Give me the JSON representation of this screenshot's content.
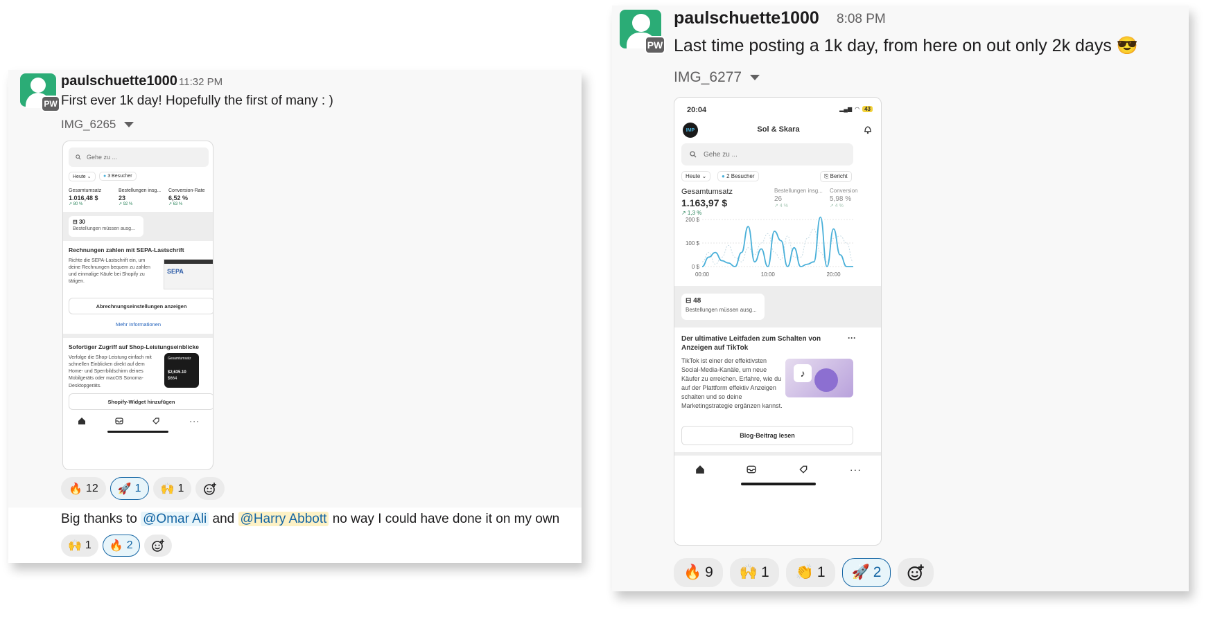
{
  "left": {
    "username": "paulschuette1000",
    "time": "11:32 PM",
    "avatar_initials": "PW",
    "message": "First ever 1k day! Hopefully the first of many : )",
    "file_name": "IMG_6265",
    "phone": {
      "search_placeholder": "Gehe zu ...",
      "filter_today": "Heute",
      "visitors": "3 Besucher",
      "metrics": [
        {
          "label": "Gesamtumsatz",
          "value": "1.016,48 $",
          "change": "↗ 80 %"
        },
        {
          "label": "Bestellungen insg...",
          "value": "23",
          "change": "↗ 92 %"
        },
        {
          "label": "Conversion-Rate",
          "value": "6,52 %",
          "change": "↗ 63 %"
        }
      ],
      "orders_count": "30",
      "orders_text": "Bestellungen müssen ausg...",
      "sepa_title": "Rechnungen zahlen mit SEPA-Lastschrift",
      "sepa_text": "Richte die SEPA-Lastschrift ein, um deine Rechnungen bequem zu zahlen und einmalige Käufe bei Shopify zu tätigen.",
      "sepa_logo": "SEPA",
      "sepa_button": "Abrechnungseinstellungen anzeigen",
      "more_info": "Mehr Informationen",
      "insights_title": "Sofortiger Zugriff auf Shop-Leistungseinblicke",
      "insights_text": "Verfolge die Shop-Leistung einfach mit schnellen Einblicken direkt auf dem Home- und Sperrbildschirm deines Mobilgeräts oder macOS Sonoma-Desktopgeräts.",
      "widget_button": "Shopify-Widget hinzufügen",
      "widget_label": "Gesamtumsatz",
      "widget_value": "$2,635.10",
      "widget_value2": "$664"
    },
    "reactions": [
      {
        "emoji": "🔥",
        "count": "12",
        "active": false
      },
      {
        "emoji": "🚀",
        "count": "1",
        "active": true
      },
      {
        "emoji": "🙌",
        "count": "1",
        "active": false
      }
    ],
    "followup": {
      "prefix": "Big thanks to",
      "mention1": "@Omar Ali",
      "middle": "and",
      "mention2": "@Harry Abbott",
      "suffix": "no way I could have done it on my own"
    },
    "followup_reactions": [
      {
        "emoji": "🙌",
        "count": "1",
        "active": false
      },
      {
        "emoji": "🔥",
        "count": "2",
        "active": true
      }
    ]
  },
  "right": {
    "username": "paulschuette1000",
    "time": "8:08 PM",
    "avatar_initials": "PW",
    "message": "Last time posting a 1k day, from here on out only 2k days",
    "message_emoji": "😎",
    "file_name": "IMG_6277",
    "phone": {
      "status_time": "20:04",
      "battery": "43",
      "store_logo": "IMP",
      "store_name": "Sol & Skara",
      "search_placeholder": "Gehe zu ...",
      "filter_today": "Heute",
      "visitors": "2 Besucher",
      "report": "Bericht",
      "metrics": [
        {
          "label": "Gesamtumsatz",
          "value": "1.163,97 $",
          "change": "↗ 1,3 %"
        },
        {
          "label": "Bestellungen insg...",
          "value": "26",
          "change": "↗ 4 %"
        },
        {
          "label": "Conversion",
          "value": "5,98 %",
          "change": "↗ 4 %"
        }
      ],
      "orders_count": "48",
      "orders_text": "Bestellungen müssen ausg...",
      "blog_title": "Der ultimative Leitfaden zum Schalten von Anzeigen auf TikTok",
      "blog_more": "···",
      "blog_text": "TikTok ist einer der effektivsten Social-Media-Kanäle, um neue Käufer zu erreichen. Erfahre, wie du auf der Plattform effektiv Anzeigen schalten und so deine Marketingstrategie ergänzen kannst.",
      "blog_button": "Blog-Beitrag lesen"
    },
    "reactions": [
      {
        "emoji": "🔥",
        "count": "9",
        "active": false
      },
      {
        "emoji": "🙌",
        "count": "1",
        "active": false
      },
      {
        "emoji": "👏",
        "count": "1",
        "active": false
      },
      {
        "emoji": "🚀",
        "count": "2",
        "active": true
      }
    ]
  },
  "chart_data": {
    "type": "line",
    "title": "",
    "xlabel": "",
    "ylabel": "",
    "x_ticks": [
      "00:00",
      "10:00",
      "20:00"
    ],
    "y_ticks": [
      "0 $",
      "100 $",
      "200 $"
    ],
    "ylim": [
      0,
      200
    ],
    "x": [
      0,
      1,
      2,
      3,
      4,
      5,
      6,
      7,
      8,
      9,
      10,
      11,
      12,
      13,
      14,
      15,
      16,
      17,
      18,
      19,
      20,
      21,
      22,
      23
    ],
    "series": [
      {
        "values": [
          0,
          40,
          60,
          25,
          15,
          0,
          60,
          170,
          20,
          75,
          0,
          150,
          110,
          0,
          80,
          0,
          10,
          20,
          210,
          0,
          160,
          50,
          0,
          0
        ],
        "color": "#4ab0d9"
      },
      {
        "values": [
          20,
          60,
          10,
          40,
          90,
          40,
          20,
          80,
          50,
          100,
          140,
          60,
          30,
          130,
          40,
          40,
          120,
          160,
          60,
          20,
          120,
          130,
          100,
          20
        ],
        "color": "#c7dbe4",
        "dashed": true
      }
    ]
  }
}
